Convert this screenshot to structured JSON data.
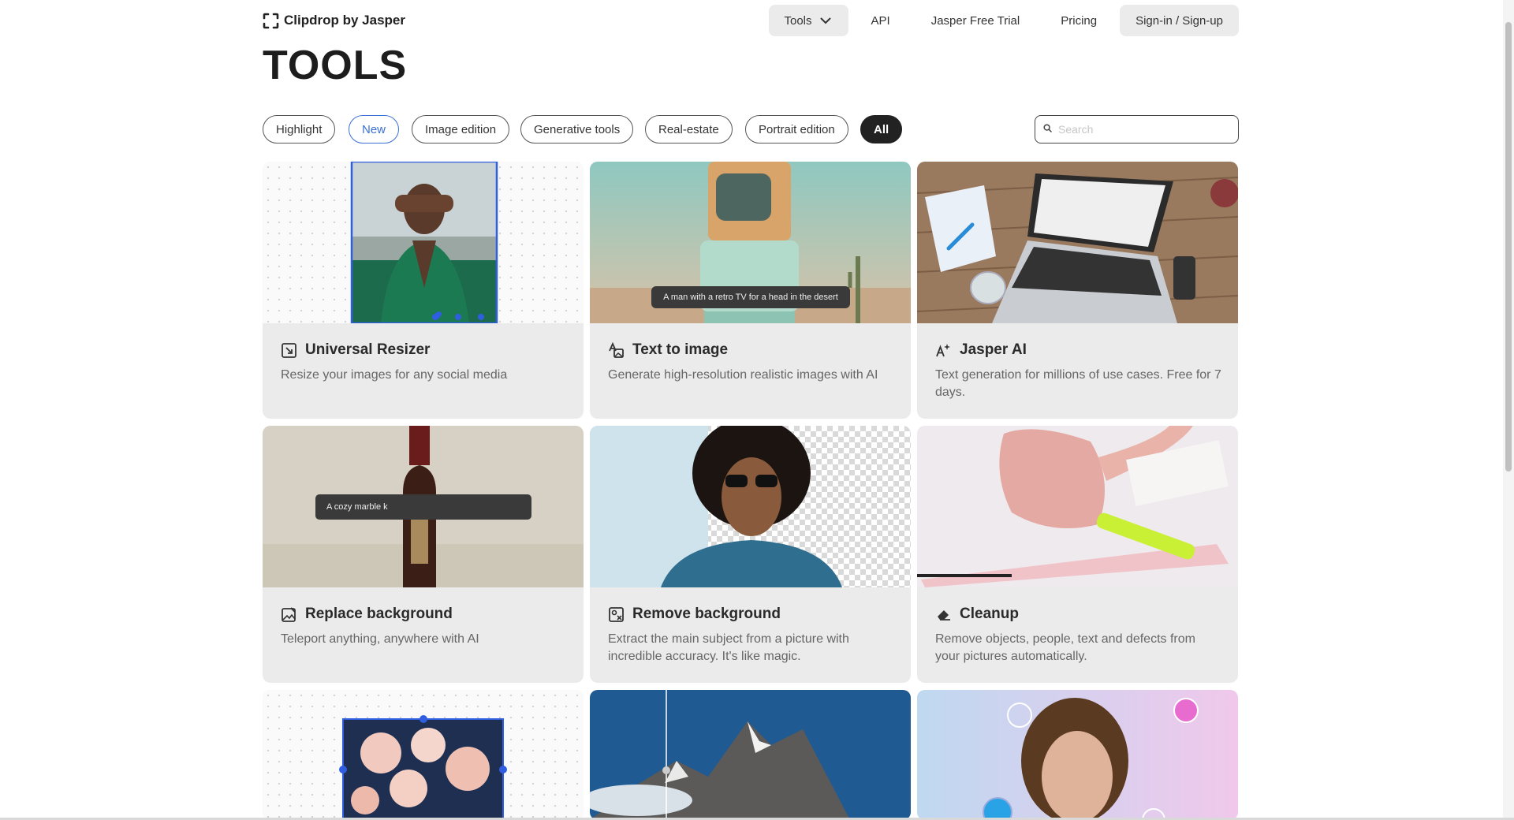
{
  "brand": {
    "name": "Clipdrop by Jasper",
    "icon": "clipdrop-logo-icon"
  },
  "nav": {
    "tools": "Tools",
    "api": "API",
    "trial": "Jasper Free Trial",
    "pricing": "Pricing",
    "signin": "Sign-in / Sign-up"
  },
  "page_title": "TOOLS",
  "filters": [
    "Highlight",
    "New",
    "Image edition",
    "Generative tools",
    "Real-estate",
    "Portrait edition",
    "All"
  ],
  "active_filter": "All",
  "search": {
    "placeholder": "Search",
    "value": ""
  },
  "cards": [
    {
      "title": "Universal Resizer",
      "desc": "Resize your images for any social media",
      "icon": "resize-icon"
    },
    {
      "title": "Text to image",
      "desc": "Generate high-resolution realistic images with AI",
      "icon": "text-to-image-icon",
      "overlay": "A man with a retro TV for a head in the desert"
    },
    {
      "title": "Jasper AI",
      "desc": "Text generation for millions of use cases. Free for 7 days.",
      "icon": "sparkle-text-icon"
    },
    {
      "title": "Replace background",
      "desc": "Teleport anything, anywhere with AI",
      "icon": "replace-background-icon",
      "overlay": "A cozy marble k"
    },
    {
      "title": "Remove background",
      "desc": "Extract the main subject from a picture with incredible accuracy. It's like magic.",
      "icon": "remove-background-icon"
    },
    {
      "title": "Cleanup",
      "desc": "Remove objects, people, text and defects from your pictures automatically.",
      "icon": "eraser-icon"
    }
  ],
  "colors": {
    "accent_blue": "#3a6fd8",
    "dark_chip": "#222222",
    "card_bg": "#ebebeb"
  }
}
